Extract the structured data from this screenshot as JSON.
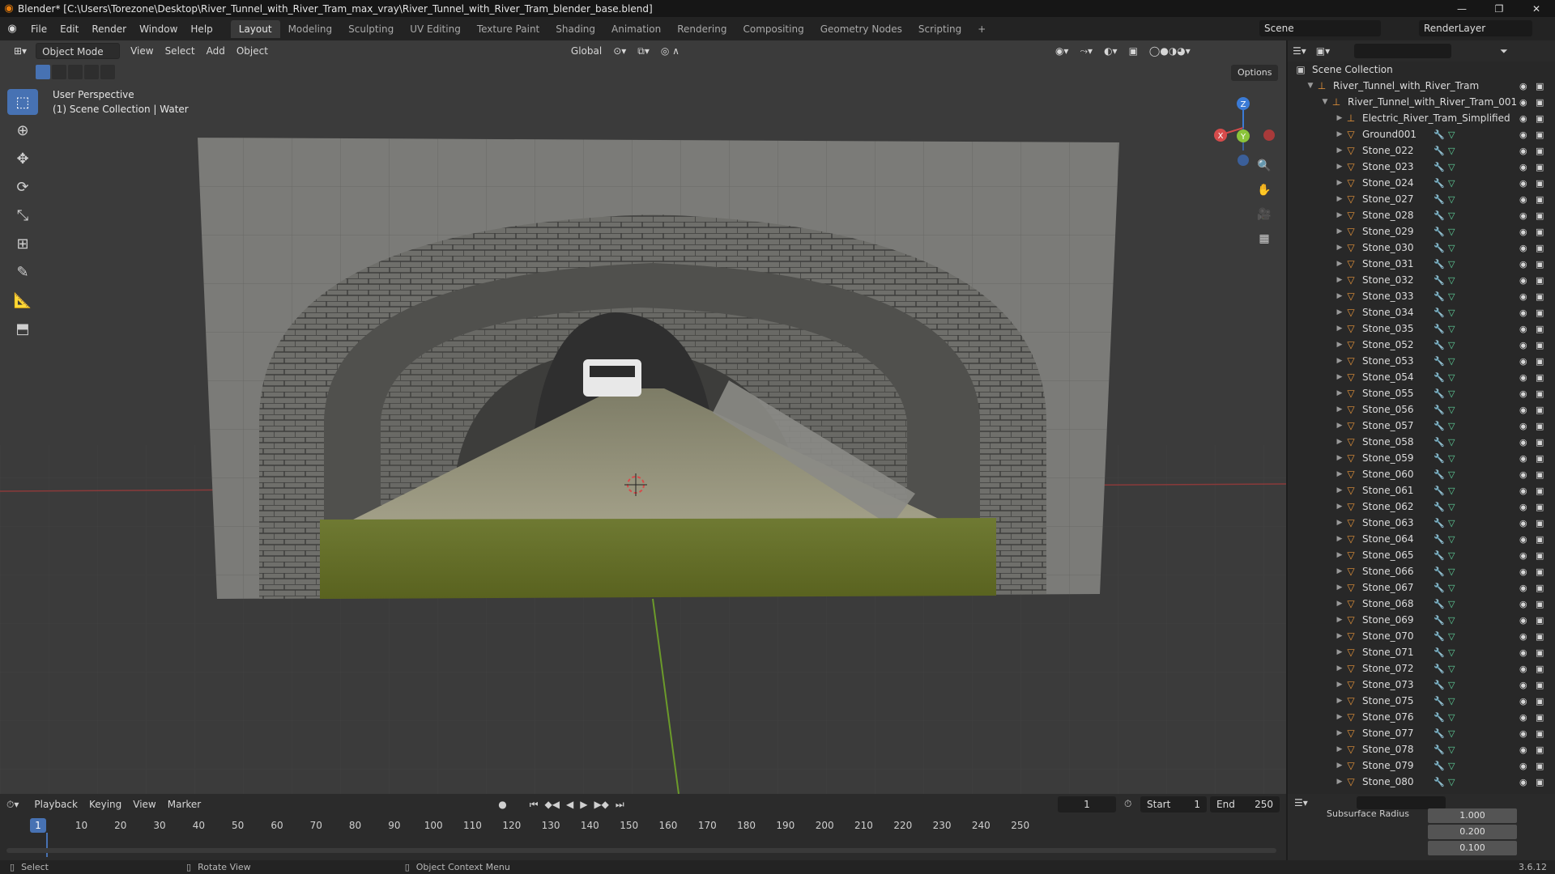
{
  "window": {
    "title": "Blender* [C:\\Users\\Torezone\\Desktop\\River_Tunnel_with_River_Tram_max_vray\\River_Tunnel_with_River_Tram_blender_base.blend]",
    "controls": [
      "—",
      "❐",
      "✕"
    ]
  },
  "menu": {
    "items": [
      "File",
      "Edit",
      "Render",
      "Window",
      "Help"
    ],
    "workspaces": [
      "Layout",
      "Modeling",
      "Sculpting",
      "UV Editing",
      "Texture Paint",
      "Shading",
      "Animation",
      "Rendering",
      "Compositing",
      "Geometry Nodes",
      "Scripting"
    ],
    "active_workspace": "Layout",
    "add_tab": "+",
    "scene": "Scene",
    "view_layer": "RenderLayer"
  },
  "viewport": {
    "mode": "Object Mode",
    "menus": [
      "View",
      "Select",
      "Add",
      "Object"
    ],
    "transform_orientation": "Global",
    "options": "Options",
    "overlay_line1": "User Perspective",
    "overlay_line2": "(1) Scene Collection | Water",
    "gizmo_axes": {
      "x": "X",
      "y": "Y",
      "z": "Z"
    }
  },
  "outliner": {
    "root": "Scene Collection",
    "collection": "River_Tunnel_with_River_Tram",
    "sub_collection": "River_Tunnel_with_River_Tram_001",
    "objects": [
      "Electric_River_Tram_Simplified",
      "Ground001",
      "Stone_022",
      "Stone_023",
      "Stone_024",
      "Stone_027",
      "Stone_028",
      "Stone_029",
      "Stone_030",
      "Stone_031",
      "Stone_032",
      "Stone_033",
      "Stone_034",
      "Stone_035",
      "Stone_052",
      "Stone_053",
      "Stone_054",
      "Stone_055",
      "Stone_056",
      "Stone_057",
      "Stone_058",
      "Stone_059",
      "Stone_060",
      "Stone_061",
      "Stone_062",
      "Stone_063",
      "Stone_064",
      "Stone_065",
      "Stone_066",
      "Stone_067",
      "Stone_068",
      "Stone_069",
      "Stone_070",
      "Stone_071",
      "Stone_072",
      "Stone_073",
      "Stone_075",
      "Stone_076",
      "Stone_077",
      "Stone_078",
      "Stone_079",
      "Stone_080"
    ]
  },
  "properties": {
    "label": "Subsurface Radius",
    "values": [
      "1.000",
      "0.200",
      "0.100"
    ]
  },
  "timeline": {
    "menus": [
      "Playback",
      "Keying",
      "View",
      "Marker"
    ],
    "current_frame": "1",
    "start_label": "Start",
    "start": "1",
    "end_label": "End",
    "end": "250",
    "ticks": [
      "10",
      "20",
      "30",
      "40",
      "50",
      "60",
      "70",
      "80",
      "90",
      "100",
      "110",
      "120",
      "130",
      "140",
      "150",
      "160",
      "170",
      "180",
      "190",
      "200",
      "210",
      "220",
      "230",
      "240",
      "250"
    ]
  },
  "status": {
    "select": "Select",
    "rotate": "Rotate View",
    "context": "Object Context Menu",
    "version": "3.6.12"
  }
}
